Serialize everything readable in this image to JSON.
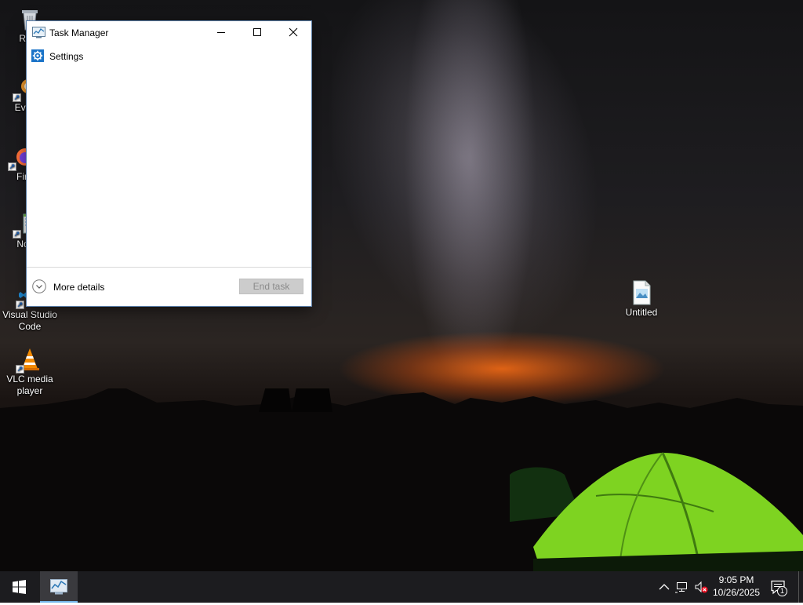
{
  "desktop": {
    "icons": [
      {
        "label": "Recy",
        "icon": "recycle-bin-icon"
      },
      {
        "label": "Every",
        "icon": "everything-search-icon"
      },
      {
        "label": "Fir",
        "icon": "firefox-icon"
      },
      {
        "label": "Note",
        "icon": "notepad-icon"
      },
      {
        "label": "Visual Studio Code",
        "icon": "vscode-icon"
      },
      {
        "label": "VLC media player",
        "icon": "vlc-icon"
      },
      {
        "label": "Untitled",
        "icon": "image-file-icon"
      }
    ]
  },
  "task_manager": {
    "title": "Task Manager",
    "processes": [
      {
        "name": "Settings",
        "icon": "settings-gear-icon"
      }
    ],
    "more_details_label": "More details",
    "end_task_label": "End task"
  },
  "taskbar": {
    "time": "9:05 PM",
    "date": "10/26/2025",
    "notification_count": "1",
    "colors": {
      "background": "#1c1c1f",
      "active_underline": "#76b9ed"
    }
  }
}
